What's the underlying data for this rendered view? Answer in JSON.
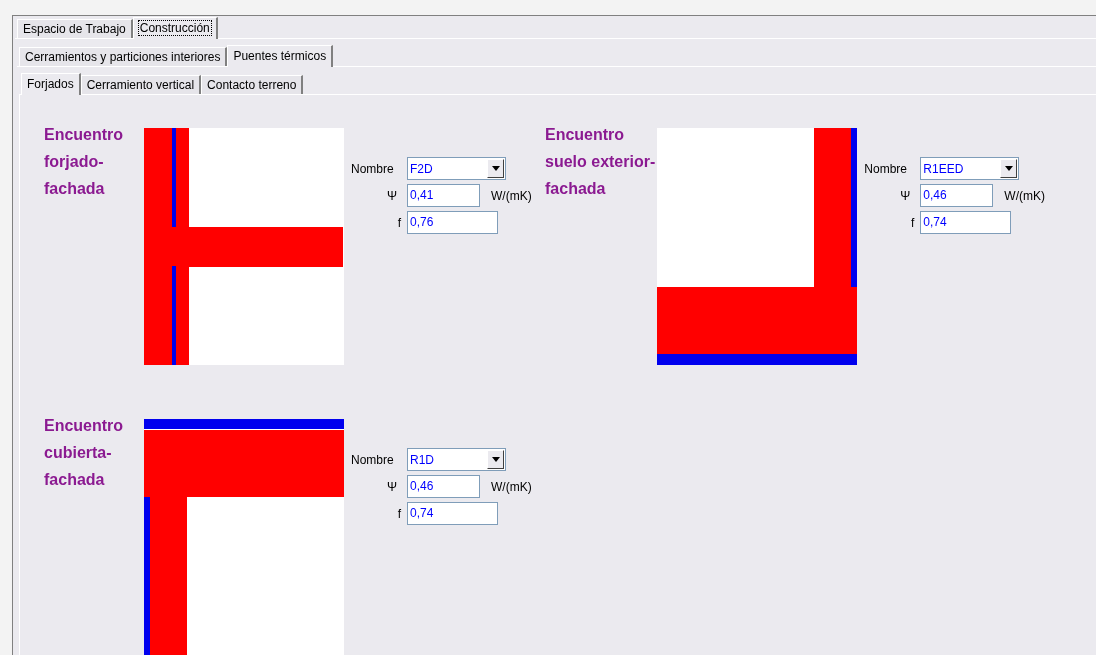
{
  "tab_rows": [
    {
      "tabs": [
        {
          "label": "Espacio de Trabajo",
          "selected": false
        },
        {
          "label": "Construcción",
          "selected": true
        }
      ]
    },
    {
      "tabs": [
        {
          "label": "Cerramientos y particiones interiores",
          "selected": false
        },
        {
          "label": "Puentes térmicos",
          "selected": true
        }
      ]
    },
    {
      "tabs": [
        {
          "label": "Forjados",
          "selected": true
        },
        {
          "label": "Cerramiento vertical",
          "selected": false
        },
        {
          "label": "Contacto terreno",
          "selected": false
        }
      ]
    }
  ],
  "junctions": [
    {
      "title_lines": [
        "Encuentro",
        "forjado-",
        "fachada"
      ],
      "kind": "tee",
      "nombre_label": "Nombre",
      "nombre": "F2D",
      "psi_label": "Ψ",
      "psi": "0,41",
      "unit": "W/(mK)",
      "f_label": "f",
      "f": "0,76"
    },
    {
      "title_lines": [
        "Encuentro",
        "suelo exterior-",
        "fachada"
      ],
      "kind": "floor",
      "nombre_label": "Nombre",
      "nombre": "R1EED",
      "psi_label": "Ψ",
      "psi": "0,46",
      "unit": "W/(mK)",
      "f_label": "f",
      "f": "0,74"
    },
    {
      "title_lines": [
        "Encuentro",
        "cubierta-",
        "fachada"
      ],
      "kind": "roof",
      "nombre_label": "Nombre",
      "nombre": "R1D",
      "psi_label": "Ψ",
      "psi": "0,46",
      "unit": "W/(mK)",
      "f_label": "f",
      "f": "0,74"
    }
  ]
}
